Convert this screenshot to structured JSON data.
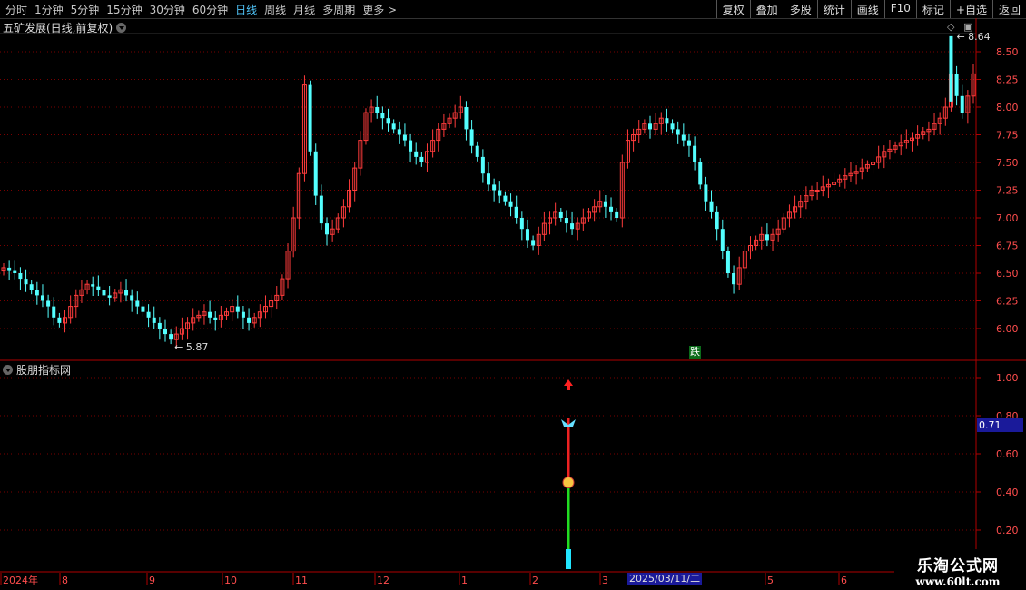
{
  "toolbar": {
    "periods": [
      "分时",
      "1分钟",
      "5分钟",
      "15分钟",
      "30分钟",
      "60分钟",
      "日线",
      "周线",
      "月线",
      "多周期",
      "更多 >"
    ],
    "active_period": "日线",
    "actions": [
      "复权",
      "叠加",
      "多股",
      "统计",
      "画线",
      "F10",
      "标记",
      "+自选",
      "返回"
    ]
  },
  "main_title": "五矿发展(日线,前复权)",
  "indicator_title": "股朋指标网",
  "price_axis": [
    "8.50",
    "8.25",
    "8.00",
    "7.75",
    "7.50",
    "7.25",
    "7.00",
    "6.75",
    "6.50",
    "6.25",
    "6.00"
  ],
  "ind_axis": [
    "1.00",
    "0.80",
    "0.60",
    "0.40",
    "0.20"
  ],
  "high_label": "8.64",
  "low_label": "5.87",
  "current_value": "0.71",
  "drop_label": "跌",
  "date_axis": [
    "2024年",
    "8",
    "9",
    "10",
    "11",
    "12",
    "1",
    "2",
    "3",
    "5",
    "6"
  ],
  "cursor_date": "2025/03/11/二",
  "watermark": {
    "line1": "乐淘公式网",
    "line2": "www.60lt.com"
  },
  "colors": {
    "up": "#ff3b3b",
    "down": "#54ffff",
    "grid": "#7a0000",
    "axis": "#b00000"
  },
  "chart_data": {
    "type": "candlestick",
    "title": "五矿发展(日线,前复权)",
    "ylim": [
      5.75,
      8.75
    ],
    "annotations": {
      "max": 8.64,
      "min": 5.87
    },
    "close_series": [
      6.55,
      6.52,
      6.5,
      6.45,
      6.4,
      6.35,
      6.3,
      6.25,
      6.2,
      6.1,
      6.05,
      6.1,
      6.2,
      6.3,
      6.35,
      6.4,
      6.38,
      6.35,
      6.3,
      6.28,
      6.32,
      6.35,
      6.3,
      6.25,
      6.2,
      6.15,
      6.1,
      6.05,
      6.0,
      5.95,
      5.9,
      5.95,
      6.0,
      6.05,
      6.1,
      6.12,
      6.15,
      6.1,
      6.08,
      6.12,
      6.15,
      6.2,
      6.15,
      6.1,
      6.05,
      6.1,
      6.15,
      6.2,
      6.25,
      6.3,
      6.45,
      6.7,
      7.0,
      7.4,
      8.2,
      7.6,
      7.2,
      6.95,
      6.85,
      6.9,
      7.0,
      7.1,
      7.25,
      7.45,
      7.7,
      7.95,
      8.0,
      7.95,
      7.9,
      7.85,
      7.8,
      7.75,
      7.7,
      7.6,
      7.55,
      7.5,
      7.6,
      7.7,
      7.8,
      7.85,
      7.9,
      7.95,
      8.0,
      7.8,
      7.65,
      7.55,
      7.4,
      7.3,
      7.25,
      7.2,
      7.15,
      7.1,
      7.0,
      6.9,
      6.8,
      6.75,
      6.85,
      6.95,
      7.0,
      7.05,
      7.0,
      6.95,
      6.9,
      6.95,
      7.0,
      7.05,
      7.1,
      7.15,
      7.1,
      7.05,
      7.0,
      7.5,
      7.7,
      7.75,
      7.8,
      7.85,
      7.8,
      7.85,
      7.9,
      7.85,
      7.8,
      7.75,
      7.7,
      7.65,
      7.5,
      7.3,
      7.15,
      7.05,
      6.9,
      6.7,
      6.5,
      6.4,
      6.55,
      6.7,
      6.75,
      6.8,
      6.85,
      6.8,
      6.85,
      6.9,
      7.0,
      7.05,
      7.1,
      7.15,
      7.2,
      7.25,
      7.25,
      7.28,
      7.3,
      7.32,
      7.35,
      7.38,
      7.4,
      7.42,
      7.45,
      7.48,
      7.5,
      7.55,
      7.6,
      7.62,
      7.65,
      7.68,
      7.7,
      7.72,
      7.75,
      7.78,
      7.8,
      7.85,
      7.9,
      8.0,
      8.3,
      8.1,
      7.95,
      8.1,
      8.3
    ],
    "indicator": {
      "series": [
        {
          "name": "line",
          "segments": [
            {
              "from": 0.0,
              "to": 0.45,
              "color": "green"
            },
            {
              "from": 0.45,
              "to": 0.79,
              "color": "red"
            }
          ]
        }
      ],
      "current": 0.71,
      "ylim": [
        0.0,
        1.1
      ]
    }
  }
}
